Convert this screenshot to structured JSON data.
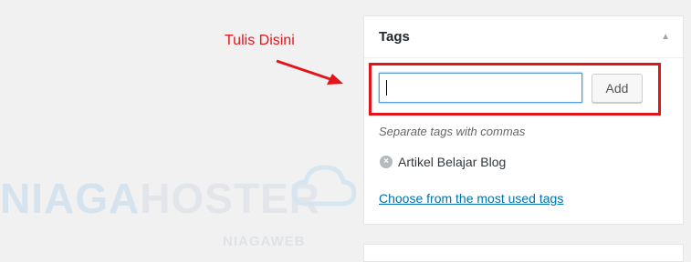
{
  "annotation": {
    "text": "Tulis Disini",
    "color": "#e3151b"
  },
  "tags_box": {
    "title": "Tags",
    "toggle_icon": "triangle-up-icon",
    "input_value": "",
    "add_button_label": "Add",
    "howto": "Separate tags with commas",
    "tags": [
      {
        "label": "Artikel Belajar Blog",
        "remove_icon": "close-circle-icon"
      }
    ],
    "most_used_link": "Choose from the most used tags"
  },
  "watermark": {
    "part_1": "NIAGA",
    "part_2": "HOSTER",
    "sub": "NIAGAWEB",
    "icon": "cloud-icon"
  },
  "colors": {
    "background": "#f1f1f1",
    "panel": "#ffffff",
    "highlight": "#e3151b",
    "link": "#0073aa"
  }
}
